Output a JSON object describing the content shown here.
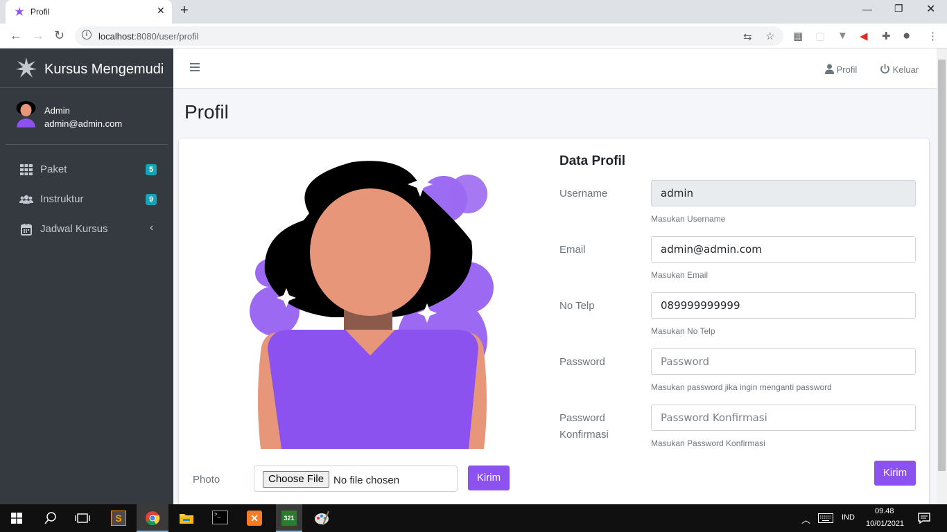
{
  "browser": {
    "tab_title": "Profil",
    "url_host": "localhost",
    "url_rest": ":8080/user/profil"
  },
  "sidebar": {
    "brand": "Kursus Mengemudi",
    "user_name": "Admin",
    "user_email": "admin@admin.com",
    "items": [
      {
        "label": "Paket",
        "badge": "5",
        "icon": "grid-icon"
      },
      {
        "label": "Instruktur",
        "badge": "9",
        "icon": "users-icon"
      },
      {
        "label": "Jadwal Kursus",
        "icon": "calendar-icon"
      }
    ]
  },
  "topnav": {
    "profil": "Profil",
    "keluar": "Keluar"
  },
  "page": {
    "title": "Profil",
    "photo_label": "Photo",
    "file_button": "Choose File",
    "file_status": "No file chosen",
    "photo_submit": "Kirim",
    "section_title": "Data Profil",
    "submit": "Kirim",
    "fields": {
      "username": {
        "label": "Username",
        "value": "admin",
        "help": "Masukan Username"
      },
      "email": {
        "label": "Email",
        "value": "admin@admin.com",
        "help": "Masukan Email"
      },
      "telp": {
        "label": "No Telp",
        "value": "089999999999",
        "help": "Masukan No Telp"
      },
      "password": {
        "label": "Password",
        "placeholder": "Password",
        "help": "Masukan password jika ingin menganti password"
      },
      "password_confirm": {
        "label_1": "Password",
        "label_2": "Konfirmasi",
        "placeholder": "Password Konfirmasi",
        "help": "Masukan Password Konfirmasi"
      }
    }
  },
  "taskbar": {
    "lang": "IND",
    "time": "09.48",
    "date": "10/01/2021"
  },
  "colors": {
    "accent": "#8b52f0",
    "sidebar": "#343a40",
    "badge": "#17a2b8"
  }
}
